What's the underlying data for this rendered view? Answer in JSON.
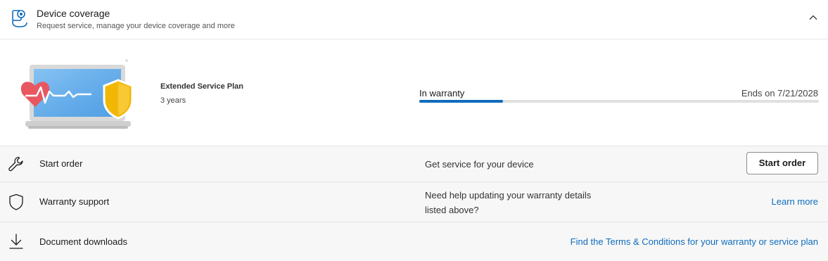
{
  "header": {
    "title": "Device coverage",
    "subtitle": "Request service, manage your device coverage and more",
    "icon": "device-support-icon",
    "collapse_icon": "chevron-up-icon"
  },
  "plan": {
    "name": "Extended Service Plan",
    "duration": "3 years",
    "illustration": "laptop-heartbeat-shield-illustration",
    "status": "In warranty",
    "ends": "Ends on 7/21/2028",
    "progress_fraction": 0.21
  },
  "rows": {
    "start_order": {
      "label": "Start order",
      "description": "Get service for your device",
      "button": "Start order",
      "icon": "wrench-icon"
    },
    "warranty_support": {
      "label": "Warranty support",
      "description_line1": "Need help updating your warranty details",
      "description_line2": "listed above?",
      "link": "Learn more",
      "icon": "shield-icon"
    },
    "document_downloads": {
      "label": "Document downloads",
      "link": "Find the Terms & Conditions for your warranty or service plan",
      "icon": "download-icon"
    }
  },
  "colors": {
    "accent": "#0f6cbd",
    "heart": "#e8565f",
    "shield": "#f2b705",
    "screen": "#5aa7e8"
  }
}
